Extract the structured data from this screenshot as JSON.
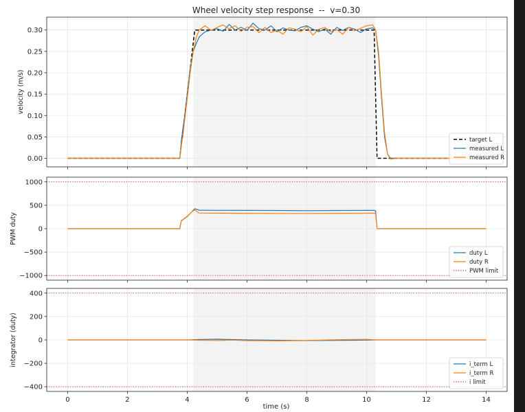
{
  "figure": {
    "title": "Wheel velocity step response  --  v=0.30",
    "xlabel": "time (s)"
  },
  "colors": {
    "background": "#1b1b1b",
    "canvas": "#ffffff",
    "blue": "#1f77b4",
    "orange": "#ff7f0e",
    "target": "#000000",
    "limit": "#d62728",
    "shade": "#ebebeb",
    "grid": "#e6e6e6"
  },
  "chart_data": [
    {
      "type": "line",
      "ylabel": "velocity (m/s)",
      "xlim": [
        -0.7,
        14.7
      ],
      "ylim": [
        -0.02,
        0.33
      ],
      "xticks": [
        0,
        2,
        4,
        6,
        8,
        10,
        12,
        14
      ],
      "yticks": [
        0.0,
        0.05,
        0.1,
        0.15,
        0.2,
        0.25,
        0.3
      ],
      "ytick_labels": [
        "0.00",
        "0.05",
        "0.10",
        "0.15",
        "0.20",
        "0.25",
        "0.30"
      ],
      "grid": true,
      "shaded_span": [
        4.2,
        10.3
      ],
      "legend_position": "lower right",
      "series": [
        {
          "name": "target L",
          "style": "dashed",
          "color": "target",
          "x": [
            0,
            3.75,
            4.25,
            10.25,
            10.35,
            14
          ],
          "y": [
            0,
            0,
            0.3,
            0.3,
            0,
            0
          ]
        },
        {
          "name": "measured L",
          "style": "solid",
          "color": "blue",
          "x": [
            0,
            3.75,
            3.8,
            3.85,
            3.9,
            4.0,
            4.1,
            4.2,
            4.3,
            4.4,
            4.5,
            4.6,
            4.8,
            5.0,
            5.2,
            5.4,
            5.6,
            5.8,
            6.0,
            6.2,
            6.4,
            6.6,
            6.8,
            7.0,
            7.2,
            7.4,
            7.6,
            7.8,
            8.0,
            8.2,
            8.4,
            8.6,
            8.8,
            9.0,
            9.2,
            9.4,
            9.6,
            9.8,
            10.0,
            10.2,
            10.3,
            10.4,
            10.5,
            10.6,
            10.7,
            10.8,
            11.0,
            14
          ],
          "y": [
            0,
            0,
            0.04,
            0.068,
            0.09,
            0.15,
            0.21,
            0.25,
            0.268,
            0.284,
            0.29,
            0.296,
            0.3,
            0.303,
            0.297,
            0.313,
            0.3,
            0.306,
            0.299,
            0.316,
            0.303,
            0.3,
            0.31,
            0.296,
            0.305,
            0.3,
            0.298,
            0.306,
            0.31,
            0.302,
            0.296,
            0.303,
            0.29,
            0.306,
            0.299,
            0.306,
            0.302,
            0.294,
            0.303,
            0.305,
            0.3,
            0.24,
            0.14,
            0.05,
            0.01,
            0.0,
            0.0,
            0.0
          ]
        },
        {
          "name": "measured R",
          "style": "solid",
          "color": "orange",
          "x": [
            0,
            3.75,
            3.8,
            3.85,
            3.9,
            4.0,
            4.1,
            4.2,
            4.3,
            4.4,
            4.5,
            4.6,
            4.8,
            5.0,
            5.2,
            5.4,
            5.6,
            5.8,
            6.0,
            6.2,
            6.4,
            6.6,
            6.8,
            7.0,
            7.2,
            7.4,
            7.6,
            7.8,
            8.0,
            8.2,
            8.4,
            8.6,
            8.8,
            9.0,
            9.2,
            9.4,
            9.6,
            9.8,
            10.0,
            10.2,
            10.3,
            10.4,
            10.5,
            10.6,
            10.7,
            10.8,
            11.0,
            14
          ],
          "y": [
            0,
            0,
            0.03,
            0.05,
            0.08,
            0.14,
            0.2,
            0.25,
            0.282,
            0.3,
            0.305,
            0.31,
            0.299,
            0.306,
            0.312,
            0.303,
            0.31,
            0.297,
            0.306,
            0.308,
            0.294,
            0.306,
            0.294,
            0.3,
            0.29,
            0.305,
            0.302,
            0.296,
            0.308,
            0.288,
            0.302,
            0.306,
            0.296,
            0.301,
            0.29,
            0.306,
            0.298,
            0.304,
            0.31,
            0.312,
            0.3,
            0.25,
            0.15,
            0.06,
            0.01,
            -0.002,
            0.0,
            0.0
          ]
        }
      ]
    },
    {
      "type": "line",
      "ylabel": "PWM duty",
      "xlim": [
        -0.7,
        14.7
      ],
      "ylim": [
        -1100,
        1100
      ],
      "xticks": [
        0,
        2,
        4,
        6,
        8,
        10,
        12,
        14
      ],
      "yticks": [
        -1000,
        -500,
        0,
        500,
        1000
      ],
      "ytick_labels": [
        "−1000",
        "−500",
        "0",
        "500",
        "1000"
      ],
      "grid": true,
      "shaded_span": [
        4.2,
        10.3
      ],
      "legend_position": "lower right",
      "series": [
        {
          "name": "duty L",
          "style": "solid",
          "color": "blue",
          "x": [
            0,
            3.75,
            3.8,
            4.0,
            4.15,
            4.25,
            4.4,
            5.0,
            6.0,
            7.0,
            8.0,
            9.0,
            10.0,
            10.25,
            10.3,
            10.35,
            14
          ],
          "y": [
            0,
            0,
            165,
            260,
            360,
            425,
            395,
            392,
            390,
            388,
            385,
            388,
            390,
            392,
            380,
            0,
            0
          ]
        },
        {
          "name": "duty R",
          "style": "solid",
          "color": "orange",
          "x": [
            0,
            3.75,
            3.8,
            4.0,
            4.15,
            4.25,
            4.4,
            5.0,
            6.0,
            7.0,
            8.0,
            9.0,
            10.0,
            10.25,
            10.3,
            10.35,
            14
          ],
          "y": [
            0,
            0,
            170,
            265,
            360,
            400,
            335,
            332,
            328,
            325,
            325,
            328,
            330,
            332,
            320,
            0,
            0
          ]
        },
        {
          "name": "PWM limit",
          "style": "dotted",
          "color": "limit",
          "hlines": [
            1000,
            -1000
          ]
        }
      ]
    },
    {
      "type": "line",
      "ylabel": "integrator (duty)",
      "xlim": [
        -0.7,
        14.7
      ],
      "ylim": [
        -440,
        440
      ],
      "xticks": [
        0,
        2,
        4,
        6,
        8,
        10,
        12,
        14
      ],
      "yticks": [
        -400,
        -200,
        0,
        200,
        400
      ],
      "ytick_labels": [
        "−400",
        "−200",
        "0",
        "200",
        "400"
      ],
      "grid": true,
      "shaded_span": [
        4.2,
        10.3
      ],
      "legend_position": "lower right",
      "series": [
        {
          "name": "i_term L",
          "style": "solid",
          "color": "blue",
          "x": [
            0,
            4.0,
            4.5,
            5.0,
            5.5,
            6.0,
            7.0,
            8.0,
            9.0,
            10.0,
            10.3,
            14
          ],
          "y": [
            0,
            0,
            4,
            6,
            3,
            0,
            -3,
            -6,
            -4,
            -2,
            0,
            0
          ]
        },
        {
          "name": "i_term R",
          "style": "solid",
          "color": "orange",
          "x": [
            0,
            4.0,
            4.5,
            5.0,
            5.5,
            6.0,
            7.0,
            8.0,
            9.0,
            10.0,
            10.3,
            14
          ],
          "y": [
            0,
            0,
            -3,
            -5,
            -2,
            -6,
            -8,
            -5,
            2,
            5,
            0,
            0
          ]
        },
        {
          "name": "i limit",
          "style": "dotted",
          "color": "limit",
          "hlines": [
            400,
            -400
          ]
        }
      ]
    }
  ]
}
